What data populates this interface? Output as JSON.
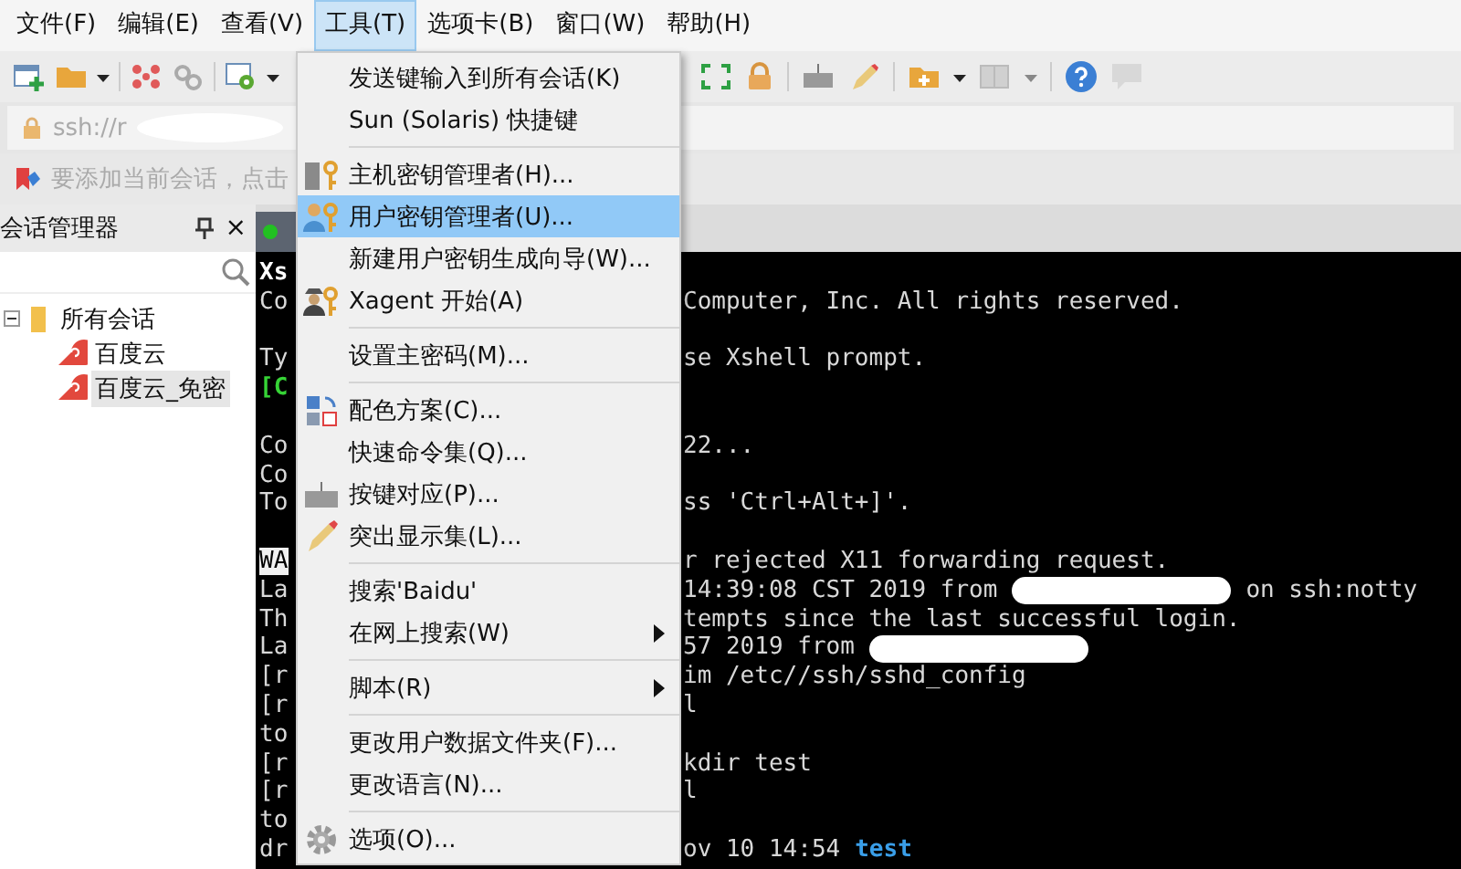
{
  "menubar": [
    {
      "label": "文件(F)",
      "selected": false
    },
    {
      "label": "编辑(E)",
      "selected": false
    },
    {
      "label": "查看(V)",
      "selected": false
    },
    {
      "label": "工具(T)",
      "selected": true
    },
    {
      "label": "选项卡(B)",
      "selected": false
    },
    {
      "label": "窗口(W)",
      "selected": false
    },
    {
      "label": "帮助(H)",
      "selected": false
    }
  ],
  "address": {
    "value": "ssh://r"
  },
  "hint": {
    "text": "要添加当前会话，点击"
  },
  "session_manager": {
    "title": "会话管理器",
    "close": "×",
    "tree": [
      {
        "label": "所有会话",
        "expanded": true,
        "selected": false,
        "children": [
          {
            "label": "百度云",
            "selected": false
          },
          {
            "label": "百度云_免密",
            "selected": true
          }
        ]
      }
    ]
  },
  "terminal": {
    "lines": [
      {
        "kind": "text",
        "left": [
          {
            "kind": "bold",
            "text": "Xs"
          }
        ]
      },
      {
        "kind": "text",
        "left": [
          {
            "kind": "plain",
            "text": "Co"
          }
        ],
        "right": [
          {
            "kind": "plain",
            "text": "Computer, Inc. All rights reserved."
          }
        ]
      },
      {
        "kind": "blank"
      },
      {
        "kind": "text",
        "left": [
          {
            "kind": "plain",
            "text": "Ty"
          }
        ],
        "right": [
          {
            "kind": "plain",
            "text": "se Xshell prompt."
          }
        ]
      },
      {
        "kind": "text",
        "left": [
          {
            "kind": "green",
            "text": "[C"
          }
        ]
      },
      {
        "kind": "blank"
      },
      {
        "kind": "text",
        "left": [
          {
            "kind": "plain",
            "text": "Co"
          }
        ],
        "right": [
          {
            "kind": "plain",
            "text": "22..."
          }
        ]
      },
      {
        "kind": "text",
        "left": [
          {
            "kind": "plain",
            "text": "Co"
          }
        ]
      },
      {
        "kind": "text",
        "left": [
          {
            "kind": "plain",
            "text": "To"
          }
        ],
        "right": [
          {
            "kind": "plain",
            "text": "ss 'Ctrl+Alt+]'."
          }
        ]
      },
      {
        "kind": "blank"
      },
      {
        "kind": "text",
        "left": [
          {
            "kind": "inverse",
            "text": "WA"
          }
        ],
        "right": [
          {
            "kind": "plain",
            "text": "r rejected X11 forwarding request."
          }
        ]
      },
      {
        "kind": "text",
        "left": [
          {
            "kind": "plain",
            "text": "La"
          }
        ],
        "right": [
          {
            "kind": "plain",
            "text": "14:39:08 CST 2019 from"
          },
          {
            "kind": "redacted"
          },
          {
            "kind": "plain",
            "text": "on ssh:notty"
          }
        ]
      },
      {
        "kind": "text",
        "left": [
          {
            "kind": "plain",
            "text": "Th"
          }
        ],
        "right": [
          {
            "kind": "plain",
            "text": "tempts since the last successful login."
          }
        ]
      },
      {
        "kind": "text",
        "left": [
          {
            "kind": "plain",
            "text": "La"
          }
        ],
        "right": [
          {
            "kind": "plain",
            "text": "57 2019 from"
          },
          {
            "kind": "redacted"
          }
        ]
      },
      {
        "kind": "text",
        "left": [
          {
            "kind": "plain",
            "text": "[r"
          }
        ],
        "right": [
          {
            "kind": "plain",
            "text": "im /etc//ssh/sshd_config"
          }
        ]
      },
      {
        "kind": "text",
        "left": [
          {
            "kind": "plain",
            "text": "[r"
          }
        ],
        "right": [
          {
            "kind": "plain",
            "text": "l"
          }
        ]
      },
      {
        "kind": "text",
        "left": [
          {
            "kind": "plain",
            "text": "to"
          }
        ]
      },
      {
        "kind": "text",
        "left": [
          {
            "kind": "plain",
            "text": "[r"
          }
        ],
        "right": [
          {
            "kind": "plain",
            "text": "kdir test"
          }
        ]
      },
      {
        "kind": "text",
        "left": [
          {
            "kind": "plain",
            "text": "[r"
          }
        ],
        "right": [
          {
            "kind": "plain",
            "text": "l"
          }
        ]
      },
      {
        "kind": "text",
        "left": [
          {
            "kind": "plain",
            "text": "to"
          }
        ]
      },
      {
        "kind": "text",
        "left": [
          {
            "kind": "plain",
            "text": "dr"
          }
        ],
        "right": [
          {
            "kind": "plain",
            "text": "ov 10 14:54"
          },
          {
            "kind": "dir",
            "text": "test"
          }
        ]
      }
    ]
  },
  "tools_menu": {
    "items": [
      {
        "kind": "item",
        "label": "发送键输入到所有会话(K)",
        "selected": false
      },
      {
        "kind": "item",
        "label": "Sun (Solaris) 快捷键",
        "selected": false
      },
      {
        "kind": "separator"
      },
      {
        "kind": "item",
        "label": "主机密钥管理者(H)...",
        "selected": false
      },
      {
        "kind": "item",
        "label": "用户密钥管理者(U)...",
        "selected": true
      },
      {
        "kind": "item",
        "label": "新建用户密钥生成向导(W)...",
        "selected": false
      },
      {
        "kind": "item",
        "label": "Xagent 开始(A)",
        "selected": false
      },
      {
        "kind": "separator"
      },
      {
        "kind": "item",
        "label": "设置主密码(M)...",
        "selected": false
      },
      {
        "kind": "separator"
      },
      {
        "kind": "item",
        "label": "配色方案(C)...",
        "selected": false
      },
      {
        "kind": "item",
        "label": "快速命令集(Q)...",
        "selected": false
      },
      {
        "kind": "item",
        "label": "按键对应(P)...",
        "selected": false
      },
      {
        "kind": "item",
        "label": "突出显示集(L)...",
        "selected": false
      },
      {
        "kind": "separator"
      },
      {
        "kind": "item",
        "label": "搜索'Baidu'",
        "selected": false
      },
      {
        "kind": "submenu",
        "label": "在网上搜索(W)",
        "selected": false
      },
      {
        "kind": "separator"
      },
      {
        "kind": "submenu",
        "label": "脚本(R)",
        "selected": false
      },
      {
        "kind": "separator"
      },
      {
        "kind": "item",
        "label": "更改用户数据文件夹(F)...",
        "selected": false
      },
      {
        "kind": "item",
        "label": "更改语言(N)...",
        "selected": false
      },
      {
        "kind": "separator"
      },
      {
        "kind": "item",
        "label": "选项(O)...",
        "selected": false
      }
    ]
  }
}
